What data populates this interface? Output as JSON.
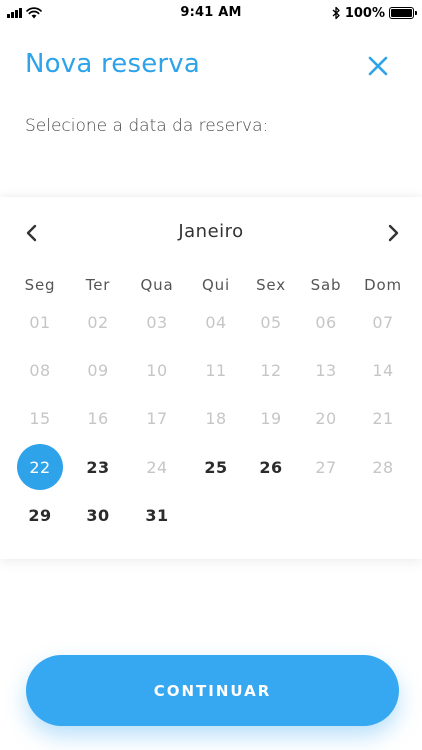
{
  "status_bar": {
    "time": "9:41 AM",
    "battery": "100%",
    "icons": [
      "signal-icon",
      "wifi-icon",
      "bluetooth-icon",
      "battery-icon"
    ]
  },
  "header": {
    "title": "Nova reserva",
    "close_icon": "close-icon"
  },
  "subtitle": "Selecione a data da reserva:",
  "calendar": {
    "month": "Janeiro",
    "prev_icon": "chevron-left-icon",
    "next_icon": "chevron-right-icon",
    "weekdays": [
      "Seg",
      "Ter",
      "Qua",
      "Qui",
      "Sex",
      "Sab",
      "Dom"
    ],
    "days": [
      {
        "label": "01",
        "state": "disabled"
      },
      {
        "label": "02",
        "state": "disabled"
      },
      {
        "label": "03",
        "state": "disabled"
      },
      {
        "label": "04",
        "state": "disabled"
      },
      {
        "label": "05",
        "state": "disabled"
      },
      {
        "label": "06",
        "state": "disabled"
      },
      {
        "label": "07",
        "state": "disabled"
      },
      {
        "label": "08",
        "state": "disabled"
      },
      {
        "label": "09",
        "state": "disabled"
      },
      {
        "label": "10",
        "state": "disabled"
      },
      {
        "label": "11",
        "state": "disabled"
      },
      {
        "label": "12",
        "state": "disabled"
      },
      {
        "label": "13",
        "state": "disabled"
      },
      {
        "label": "14",
        "state": "disabled"
      },
      {
        "label": "15",
        "state": "disabled"
      },
      {
        "label": "16",
        "state": "disabled"
      },
      {
        "label": "17",
        "state": "disabled"
      },
      {
        "label": "18",
        "state": "disabled"
      },
      {
        "label": "19",
        "state": "disabled"
      },
      {
        "label": "20",
        "state": "disabled"
      },
      {
        "label": "21",
        "state": "disabled"
      },
      {
        "label": "22",
        "state": "selected"
      },
      {
        "label": "23",
        "state": "available"
      },
      {
        "label": "24",
        "state": "disabled"
      },
      {
        "label": "25",
        "state": "available"
      },
      {
        "label": "26",
        "state": "available"
      },
      {
        "label": "27",
        "state": "disabled"
      },
      {
        "label": "28",
        "state": "disabled"
      },
      {
        "label": "29",
        "state": "available"
      },
      {
        "label": "30",
        "state": "available"
      },
      {
        "label": "31",
        "state": "available"
      }
    ]
  },
  "continue_label": "CONTINUAR",
  "colors": {
    "accent": "#2ea3ea",
    "button": "#36a7f1",
    "disabled_day": "#c6c6c6",
    "available_day": "#2b2b2b"
  }
}
